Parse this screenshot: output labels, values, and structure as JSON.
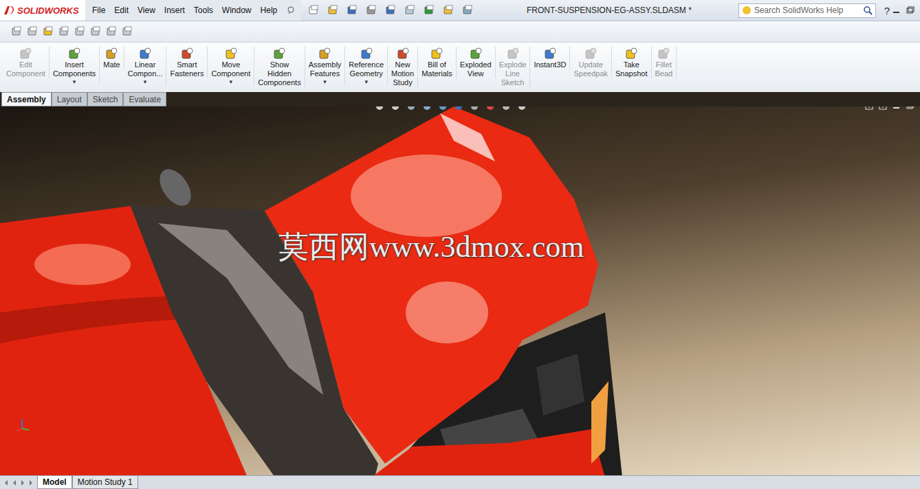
{
  "app": {
    "logo": "SOLIDWORKS"
  },
  "menu": [
    "File",
    "Edit",
    "View",
    "Insert",
    "Tools",
    "Window",
    "Help"
  ],
  "window": {
    "title": "FRONT-SUSPENSION-EG-ASSY.SLDASM *"
  },
  "search": {
    "placeholder": "Search SolidWorks Help"
  },
  "help": {
    "label": "?"
  },
  "dropdown_glyph": "▾",
  "ribbon": [
    {
      "lines": [
        "Edit",
        "Component"
      ],
      "disabled": true,
      "dropdown": false
    },
    {
      "lines": [
        "Insert",
        "Components"
      ],
      "disabled": false,
      "dropdown": true
    },
    {
      "lines": [
        "Mate"
      ],
      "disabled": false,
      "dropdown": false
    },
    {
      "lines": [
        "Linear",
        "Compon..."
      ],
      "disabled": false,
      "dropdown": true
    },
    {
      "lines": [
        "Smart",
        "Fasteners"
      ],
      "disabled": false,
      "dropdown": false
    },
    {
      "lines": [
        "Move",
        "Component"
      ],
      "disabled": false,
      "dropdown": true
    },
    {
      "lines": [
        "Show",
        "Hidden",
        "Components"
      ],
      "disabled": false,
      "dropdown": false
    },
    {
      "lines": [
        "Assembly",
        "Features"
      ],
      "disabled": false,
      "dropdown": true
    },
    {
      "lines": [
        "Reference",
        "Geometry"
      ],
      "disabled": false,
      "dropdown": true
    },
    {
      "lines": [
        "New",
        "Motion",
        "Study"
      ],
      "disabled": false,
      "dropdown": false
    },
    {
      "lines": [
        "Bill of",
        "Materials"
      ],
      "disabled": false,
      "dropdown": false
    },
    {
      "lines": [
        "Exploded",
        "View"
      ],
      "disabled": false,
      "dropdown": false
    },
    {
      "lines": [
        "Explode",
        "Line",
        "Sketch"
      ],
      "disabled": true,
      "dropdown": false
    },
    {
      "lines": [
        "Instant3D"
      ],
      "disabled": false,
      "dropdown": false
    },
    {
      "lines": [
        "Update",
        "Speedpak"
      ],
      "disabled": true,
      "dropdown": false
    },
    {
      "lines": [
        "Take",
        "Snapshot"
      ],
      "disabled": false,
      "dropdown": false
    },
    {
      "lines": [
        "Fillet",
        "Bead"
      ],
      "disabled": true,
      "dropdown": false
    }
  ],
  "tabs": [
    {
      "label": "Assembly",
      "selected": true
    },
    {
      "label": "Layout",
      "selected": false
    },
    {
      "label": "Sketch",
      "selected": false
    },
    {
      "label": "Evaluate",
      "selected": false
    }
  ],
  "watermark": "莫西网www.3dmox.com",
  "bottom_tabs": [
    {
      "label": "Model",
      "selected": true
    },
    {
      "label": "Motion Study 1",
      "selected": false
    }
  ]
}
